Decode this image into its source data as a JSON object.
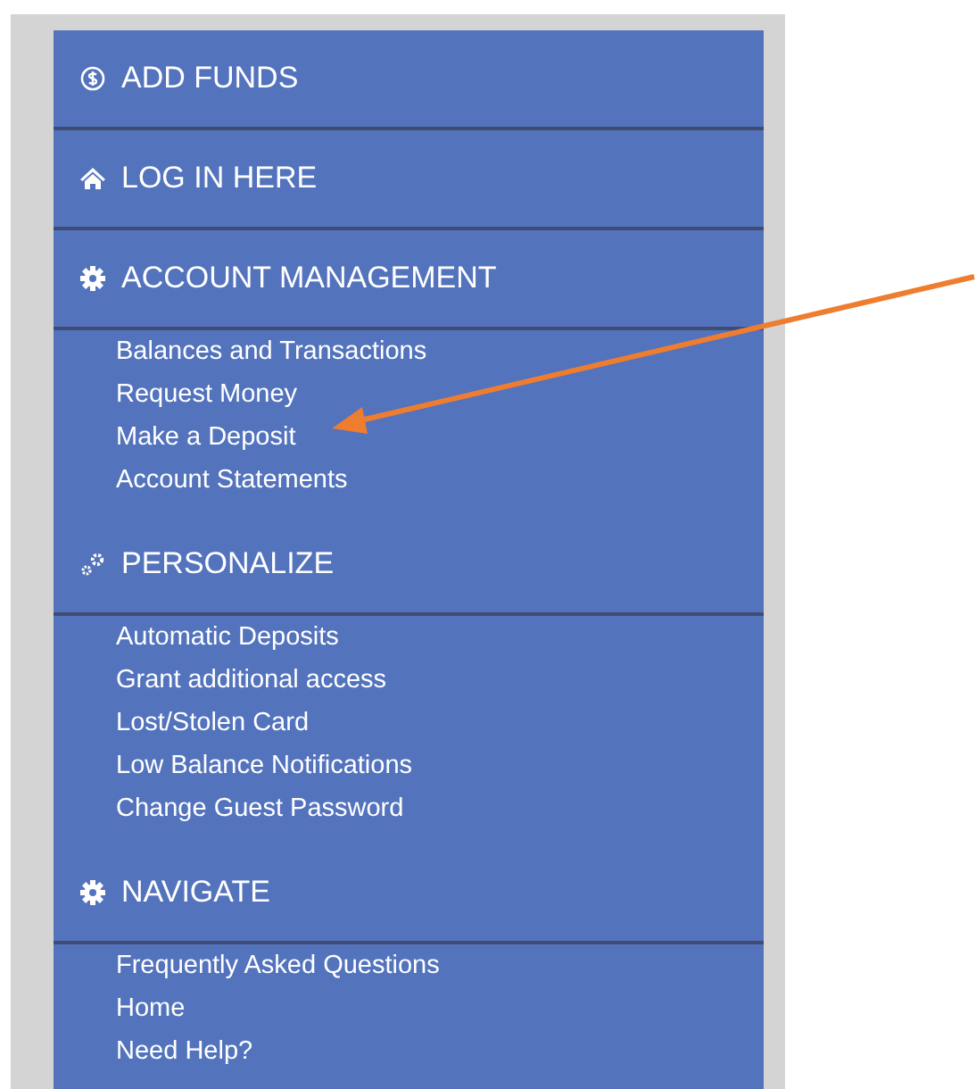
{
  "menu": [
    {
      "title": "ADD FUNDS"
    },
    {
      "title": "LOG IN HERE"
    },
    {
      "title": "ACCOUNT MANAGEMENT",
      "links": [
        "Balances and Transactions",
        "Request Money",
        "Make a Deposit",
        "Account Statements"
      ]
    },
    {
      "title": "PERSONALIZE",
      "links": [
        "Automatic Deposits",
        "Grant additional access",
        "Lost/Stolen Card",
        "Low Balance Notifications",
        "Change Guest Password"
      ]
    },
    {
      "title": "NAVIGATE",
      "links": [
        "Frequently Asked Questions",
        "Home",
        "Need Help?"
      ]
    }
  ]
}
